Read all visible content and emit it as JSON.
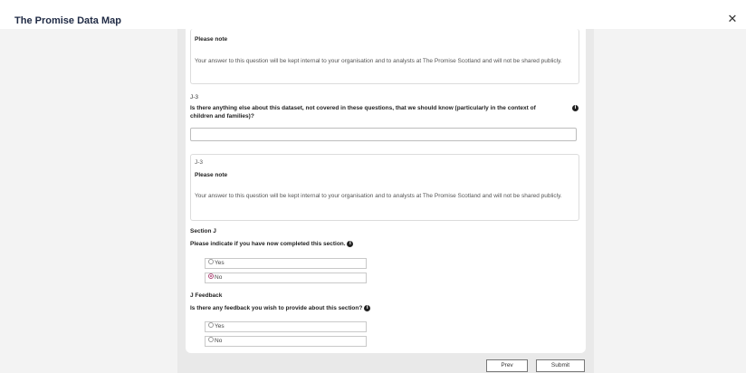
{
  "app": {
    "title": "The Promise Data Map"
  },
  "note1": {
    "heading": "Please note",
    "text": "Your answer to this question will be kept internal to your organisation and to analysts at The Promise Scotland and will not be shared publicly."
  },
  "question_j3": {
    "code": "J-3",
    "text": "Is there anything else about this dataset, not covered in these questions, that we should know (particularly in the context of children and families)?",
    "value": ""
  },
  "note2": {
    "code": "J-3",
    "heading": "Please note",
    "text": "Your answer to this question will be kept internal to your organisation and to analysts at The Promise Scotland and will not be shared publicly."
  },
  "section_j": {
    "heading": "Section J",
    "question": "Please indicate if you have now completed this section.",
    "options": [
      "Yes",
      "No"
    ],
    "selected": "No"
  },
  "j_feedback": {
    "heading": "J Feedback",
    "question": "Is there any feedback you wish to provide about this section?",
    "options": [
      "Yes",
      "No"
    ],
    "selected": ""
  },
  "buttons": {
    "prev": "Prev",
    "submit": "Submit"
  },
  "icons": {
    "info": "info-icon",
    "close": "close-icon"
  },
  "colors": {
    "radio_selected": "#b04a7a"
  }
}
